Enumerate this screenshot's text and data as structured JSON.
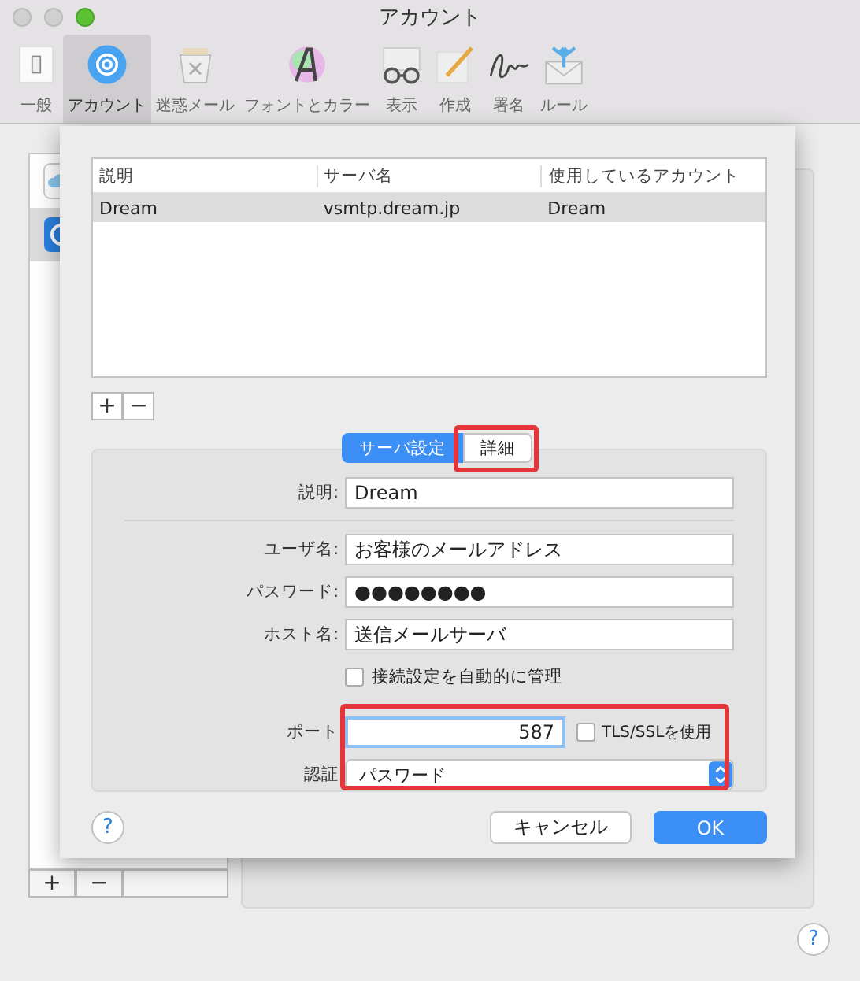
{
  "window": {
    "title": "アカウント"
  },
  "toolbar": [
    {
      "label": "一般",
      "kind": "general",
      "selected": false
    },
    {
      "label": "アカウント",
      "kind": "accounts",
      "selected": true
    },
    {
      "label": "迷惑メール",
      "kind": "junk",
      "selected": false
    },
    {
      "label": "フォントとカラー",
      "kind": "fonts",
      "selected": false
    },
    {
      "label": "表示",
      "kind": "viewing",
      "selected": false
    },
    {
      "label": "作成",
      "kind": "composing",
      "selected": false
    },
    {
      "label": "署名",
      "kind": "signatures",
      "selected": false
    },
    {
      "label": "ルール",
      "kind": "rules",
      "selected": false
    }
  ],
  "account_list": {
    "items": [
      {
        "kind": "cloud",
        "selected": false
      },
      {
        "kind": "at",
        "selected": true
      }
    ],
    "add_button": "+",
    "remove_button": "−"
  },
  "sheet": {
    "table": {
      "columns": [
        "説明",
        "サーバ名",
        "使用しているアカウント"
      ],
      "rows": [
        {
          "cells": [
            "Dream",
            "vsmtp.dream.jp",
            "Dream"
          ],
          "selected": true
        }
      ]
    },
    "add_button": "+",
    "remove_button": "−",
    "tabs": [
      {
        "label": "サーバ設定",
        "selected": true,
        "highlighted": false
      },
      {
        "label": "詳細",
        "selected": false,
        "highlighted": true
      }
    ],
    "description": {
      "label": "説明:",
      "value": "Dream"
    },
    "fields": [
      {
        "label": "ユーザ名:",
        "value": "お客様のメールアドレス"
      },
      {
        "label": "パスワード:",
        "value": "●●●●●●●●"
      },
      {
        "label": "ホスト名:",
        "value": "送信メールサーバ"
      }
    ],
    "auto_manage": {
      "label": "接続設定を自動的に管理",
      "checked": false
    },
    "highlighted": true,
    "port": {
      "label": "ポート",
      "value": "587"
    },
    "tls": {
      "label": "TLS/SSLを使用",
      "checked": false
    },
    "auth": {
      "label": "認証",
      "value": "パスワード"
    },
    "help": "?",
    "cancel": "キャンセル",
    "ok": "OK"
  },
  "help": "?"
}
